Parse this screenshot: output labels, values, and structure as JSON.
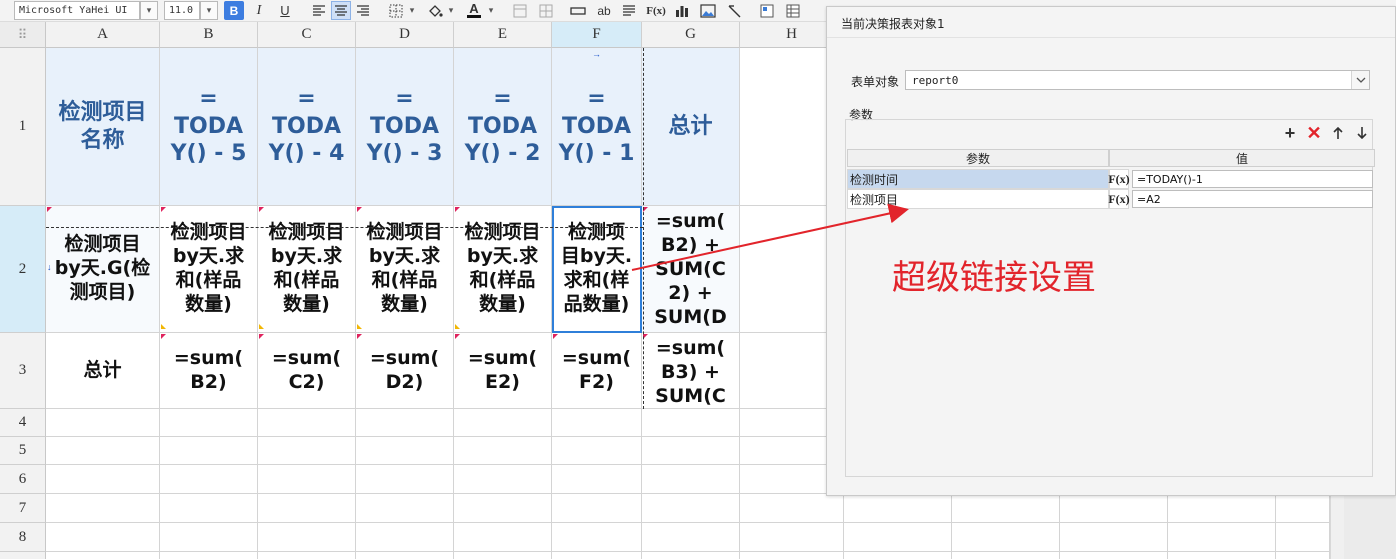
{
  "toolbar": {
    "font_name": "Microsoft YaHei UI",
    "font_size": "11.0",
    "bold_label": "B",
    "italic_label": "I",
    "underline_label": "U",
    "font_color_label": "A",
    "text_tool_label": "ab",
    "formula_tool_label": "F(x)"
  },
  "sheet": {
    "columns": [
      "A",
      "B",
      "C",
      "D",
      "E",
      "F",
      "G",
      "H"
    ],
    "rows": [
      "1",
      "2",
      "3",
      "4",
      "5",
      "6",
      "7",
      "8"
    ],
    "selected_column": "F",
    "selected_row": "2",
    "selected_cell": "F2",
    "cells": {
      "A1": "检测项目\n名称",
      "B1": "=\nTODA\nY() - 5",
      "C1": "=\nTODA\nY() - 4",
      "D1": "=\nTODA\nY() - 3",
      "E1": "=\nTODA\nY() - 2",
      "F1": "=\nTODA\nY() - 1",
      "G1": "总计",
      "A2": "检测项目\nby天.G(检\n测项目)",
      "B2": "检测项目\nby天.求\n和(样品\n数量)",
      "C2": "检测项目\nby天.求\n和(样品\n数量)",
      "D2": "检测项目\nby天.求\n和(样品\n数量)",
      "E2": "检测项目\nby天.求\n和(样品\n数量)",
      "F2": "检测项\n目by天.\n求和(样\n品数量)",
      "G2": "=sum(\nB2) +\nSUM(C\n2) +\nSUM(D",
      "A3": "总计",
      "B3": "=sum(\nB2)",
      "C3": "=sum(\nC2)",
      "D3": "=sum(\nD2)",
      "E3": "=sum(\nE2)",
      "F3": "=sum(\nF2)",
      "G3": "=sum(\nB3) +\nSUM(C"
    }
  },
  "panel": {
    "title": "当前决策报表对象1",
    "form_object_label": "表单对象",
    "form_object_value": "report0",
    "params_group_label": "参数",
    "table_headers": [
      "参数",
      "值"
    ],
    "params": [
      {
        "name": "检测时间",
        "fx": "F(x)",
        "value": "=TODAY()-1"
      },
      {
        "name": "检测项目",
        "fx": "F(x)",
        "value": "=A2"
      }
    ]
  },
  "annotation": {
    "text": "超级链接设置",
    "color": "#e2242b"
  },
  "colors": {
    "header_fill": "#e8f1fb",
    "header_text": "#2e5d99",
    "selection": "#2f7fd9",
    "accent_red": "#e2242b"
  }
}
